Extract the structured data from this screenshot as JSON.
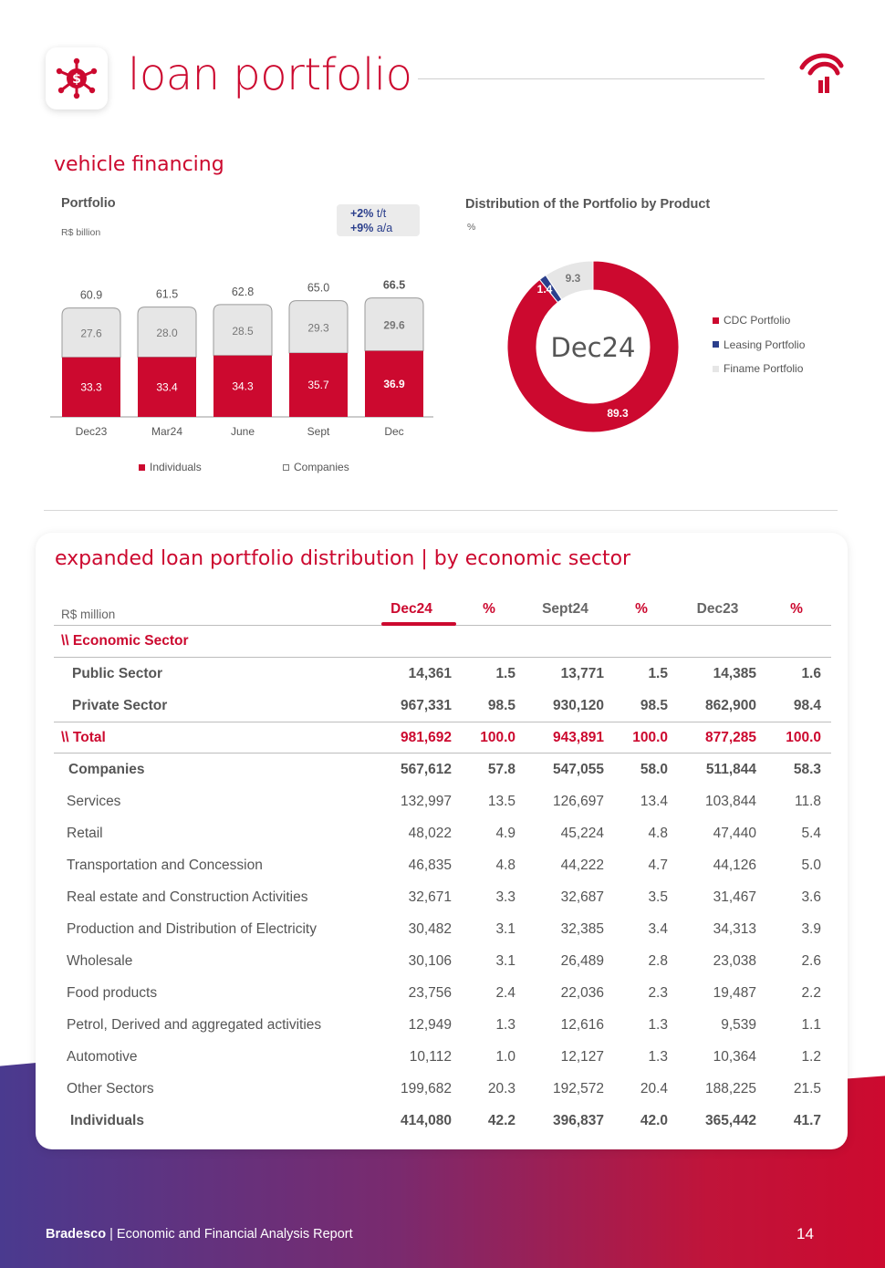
{
  "header": {
    "title": "loan portfolio",
    "icon": "money-network-icon",
    "logo": "bradesco-logo"
  },
  "vehicle": {
    "section_title": "vehicle financing",
    "portfolio_title": "Portfolio",
    "portfolio_unit": "R$ billion",
    "growth": {
      "qoq_value": "+2%",
      "qoq_label": "t/t",
      "yoy_value": "+9%",
      "yoy_label": "a/a"
    },
    "legend": {
      "individuals": "Individuals",
      "companies": "Companies"
    },
    "distribution_title": "Distribution of the Portfolio by Product",
    "distribution_unit": "%",
    "donut_center": "Dec24",
    "donut_legend": [
      "CDC Portfolio",
      "Leasing Portfolio",
      "Finame Portfolio"
    ]
  },
  "chart_data": [
    {
      "type": "bar",
      "stacked": true,
      "title": "Portfolio",
      "ylabel": "R$ billion",
      "categories": [
        "Dec23",
        "Mar24",
        "June",
        "Sept",
        "Dec"
      ],
      "series": [
        {
          "name": "Individuals",
          "values": [
            33.3,
            33.4,
            34.3,
            35.7,
            36.9
          ],
          "color": "#cc092f"
        },
        {
          "name": "Companies",
          "values": [
            27.6,
            28.0,
            28.5,
            29.3,
            29.6
          ],
          "color": "#e6e6e6"
        }
      ],
      "totals": [
        "60.9",
        "61.5",
        "62.8",
        "65.0",
        "66.5"
      ],
      "ylim": [
        0,
        70
      ],
      "legend": "bottom"
    },
    {
      "type": "pie",
      "donut": true,
      "title": "Distribution of the Portfolio by Product",
      "unit": "%",
      "center_label": "Dec24",
      "slices": [
        {
          "name": "CDC Portfolio",
          "value": 89.3,
          "color": "#cc092f"
        },
        {
          "name": "Leasing Portfolio",
          "value": 1.4,
          "color": "#2b3f8c"
        },
        {
          "name": "Finame Portfolio",
          "value": 9.3,
          "color": "#e6e6e6"
        }
      ],
      "legend": "right"
    }
  ],
  "table": {
    "title": "expanded loan portfolio distribution | by economic sector",
    "unit": "R$ million",
    "columns": [
      "Dec24",
      "%",
      "Sept24",
      "%",
      "Dec23",
      "%"
    ],
    "section_label": "\\\\ Economic Sector",
    "rows_top": [
      {
        "label": "Public Sector",
        "v": [
          "14,361",
          "1.5",
          "13,771",
          "1.5",
          "14,385",
          "1.6"
        ]
      },
      {
        "label": "Private Sector",
        "v": [
          "967,331",
          "98.5",
          "930,120",
          "98.5",
          "862,900",
          "98.4"
        ]
      }
    ],
    "total": {
      "label": "\\\\ Total",
      "v": [
        "981,692",
        "100.0",
        "943,891",
        "100.0",
        "877,285",
        "100.0"
      ]
    },
    "companies": {
      "label": "Companies",
      "v": [
        "567,612",
        "57.8",
        "547,055",
        "58.0",
        "511,844",
        "58.3"
      ]
    },
    "rows_sectors": [
      {
        "label": "Services",
        "v": [
          "132,997",
          "13.5",
          "126,697",
          "13.4",
          "103,844",
          "11.8"
        ]
      },
      {
        "label": "Retail",
        "v": [
          "48,022",
          "4.9",
          "45,224",
          "4.8",
          "47,440",
          "5.4"
        ]
      },
      {
        "label": "Transportation and Concession",
        "v": [
          "46,835",
          "4.8",
          "44,222",
          "4.7",
          "44,126",
          "5.0"
        ]
      },
      {
        "label": "Real estate and Construction Activities",
        "v": [
          "32,671",
          "3.3",
          "32,687",
          "3.5",
          "31,467",
          "3.6"
        ]
      },
      {
        "label": "Production and Distribution of Electricity",
        "v": [
          "30,482",
          "3.1",
          "32,385",
          "3.4",
          "34,313",
          "3.9"
        ]
      },
      {
        "label": "Wholesale",
        "v": [
          "30,106",
          "3.1",
          "26,489",
          "2.8",
          "23,038",
          "2.6"
        ]
      },
      {
        "label": "Food products",
        "v": [
          "23,756",
          "2.4",
          "22,036",
          "2.3",
          "19,487",
          "2.2"
        ]
      },
      {
        "label": "Petrol, Derived and aggregated activities",
        "v": [
          "12,949",
          "1.3",
          "12,616",
          "1.3",
          "9,539",
          "1.1"
        ]
      },
      {
        "label": "Automotive",
        "v": [
          "10,112",
          "1.0",
          "12,127",
          "1.3",
          "10,364",
          "1.2"
        ]
      },
      {
        "label": "Other Sectors",
        "v": [
          "199,682",
          "20.3",
          "192,572",
          "20.4",
          "188,225",
          "21.5"
        ]
      }
    ],
    "individuals": {
      "label": "Individuals",
      "v": [
        "414,080",
        "42.2",
        "396,837",
        "42.0",
        "365,442",
        "41.7"
      ]
    }
  },
  "footer": {
    "brand": "Bradesco",
    "text": " | Economic and Financial Analysis Report",
    "page": "14"
  }
}
